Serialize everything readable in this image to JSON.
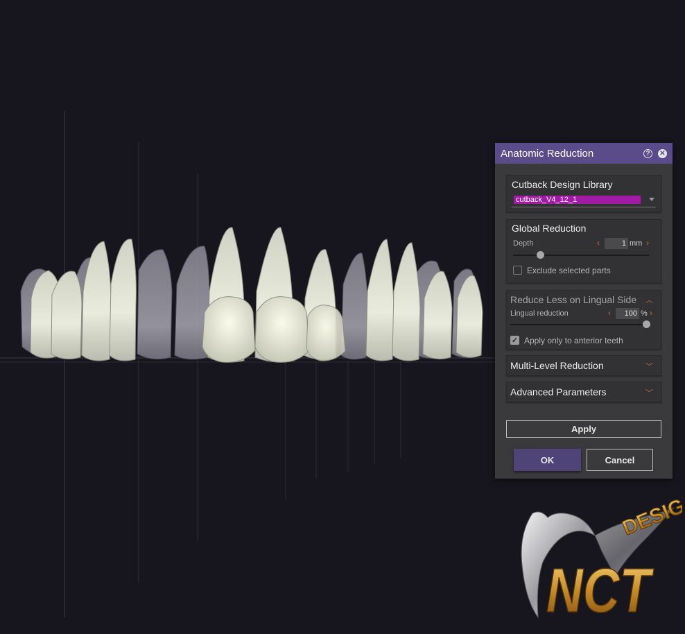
{
  "dialog": {
    "title": "Anatomic Reduction",
    "help_icon": "help-icon",
    "close_icon": "close-icon"
  },
  "library": {
    "title": "Cutback Design Library",
    "selected": "cutback_V4_12_1"
  },
  "global_reduction": {
    "title": "Global Reduction",
    "depth_label": "Depth",
    "depth_value": "1",
    "depth_unit": "mm",
    "depth_fraction": 0.2,
    "exclude_label": "Exclude selected parts",
    "exclude_checked": false
  },
  "lingual": {
    "title": "Reduce Less on Lingual Side",
    "reduction_label": "Lingual reduction",
    "reduction_value": "100",
    "reduction_unit": "%",
    "reduction_fraction": 1.0,
    "anterior_label": "Apply only to anterior teeth",
    "anterior_checked": true
  },
  "multi_level": {
    "title": "Multi-Level Reduction"
  },
  "advanced": {
    "title": "Advanced Parameters"
  },
  "buttons": {
    "apply": "Apply",
    "ok": "OK",
    "cancel": "Cancel"
  },
  "logo": {
    "line1": "DESIGN",
    "line2": "NCT"
  },
  "colors": {
    "header": "#5a4c8a",
    "accent_arrow": "#d06b3c",
    "selected_library": "#a21aa6",
    "logo_gold": "#d9a53a"
  }
}
